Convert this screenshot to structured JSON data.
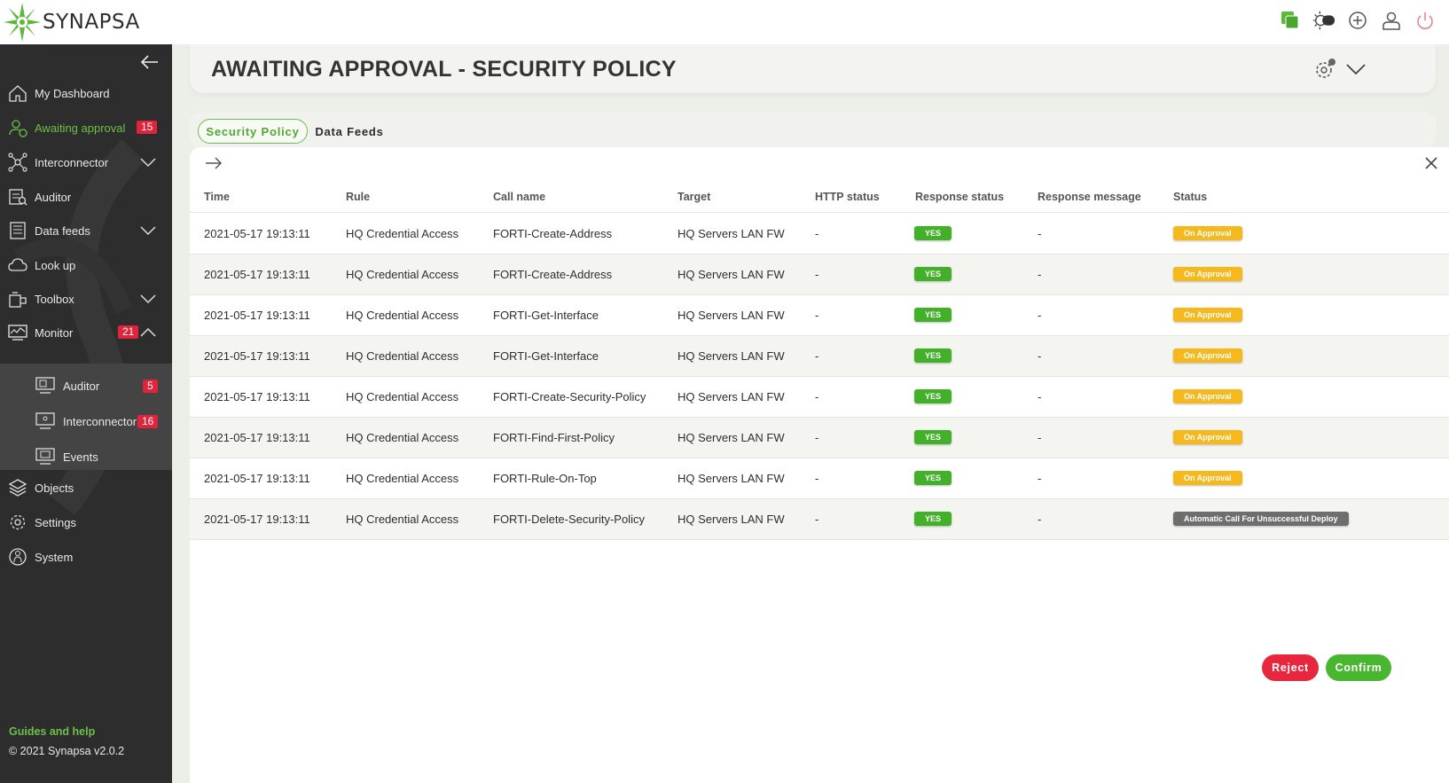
{
  "app": {
    "name": "SYNAPSA"
  },
  "topbar": {
    "icons": [
      "green-square-icon",
      "theme-toggle-icon",
      "add-circle-icon",
      "user-icon",
      "power-icon"
    ]
  },
  "sidebar": {
    "items": [
      {
        "label": "My Dashboard",
        "icon": "home-icon"
      },
      {
        "label": "Awaiting approval",
        "icon": "approval-user-icon",
        "badge": "15",
        "active": true
      },
      {
        "label": "Interconnector",
        "icon": "network-icon",
        "expandable": true
      },
      {
        "label": "Auditor",
        "icon": "auditor-icon"
      },
      {
        "label": "Data feeds",
        "icon": "data-feeds-icon",
        "expandable": true
      },
      {
        "label": "Look up",
        "icon": "cloud-icon"
      },
      {
        "label": "Toolbox",
        "icon": "toolbox-icon",
        "expandable": true
      },
      {
        "label": "Monitor",
        "icon": "monitor-icon",
        "badge": "21",
        "expanded": true
      },
      {
        "label": "Objects",
        "icon": "layers-icon"
      },
      {
        "label": "Settings",
        "icon": "settings-icon"
      },
      {
        "label": "System",
        "icon": "system-icon"
      }
    ],
    "monitor_sub": [
      {
        "label": "Auditor",
        "badge": "5"
      },
      {
        "label": "Interconnector",
        "badge": "16"
      },
      {
        "label": "Events",
        "badge": ""
      }
    ],
    "guides": "Guides and help",
    "copyright": "© 2021 Synapsa v2.0.2"
  },
  "header": {
    "title": "AWAITING APPROVAL - SECURITY POLICY"
  },
  "tabs": [
    {
      "label": "Security Policy",
      "active": true
    },
    {
      "label": "Data Feeds",
      "active": false
    }
  ],
  "table": {
    "columns": [
      "Time",
      "Rule",
      "Call name",
      "Target",
      "HTTP status",
      "Response status",
      "Response message",
      "Status"
    ],
    "rows": [
      {
        "time": "2021-05-17 19:13:11",
        "rule": "HQ Credential Access",
        "call": "FORTI-Create-Address",
        "target": "HQ Servers LAN FW",
        "http": "-",
        "response": "YES",
        "message": "-",
        "status": "On Approval",
        "status_color": "#f6b91d"
      },
      {
        "time": "2021-05-17 19:13:11",
        "rule": "HQ Credential Access",
        "call": "FORTI-Create-Address",
        "target": "HQ Servers LAN FW",
        "http": "-",
        "response": "YES",
        "message": "-",
        "status": "On Approval",
        "status_color": "#f6b91d"
      },
      {
        "time": "2021-05-17 19:13:11",
        "rule": "HQ Credential Access",
        "call": "FORTI-Get-Interface",
        "target": "HQ Servers LAN FW",
        "http": "-",
        "response": "YES",
        "message": "-",
        "status": "On Approval",
        "status_color": "#f6b91d"
      },
      {
        "time": "2021-05-17 19:13:11",
        "rule": "HQ Credential Access",
        "call": "FORTI-Get-Interface",
        "target": "HQ Servers LAN FW",
        "http": "-",
        "response": "YES",
        "message": "-",
        "status": "On Approval",
        "status_color": "#f6b91d"
      },
      {
        "time": "2021-05-17 19:13:11",
        "rule": "HQ Credential Access",
        "call": "FORTI-Create-Security-Policy",
        "target": "HQ Servers LAN FW",
        "http": "-",
        "response": "YES",
        "message": "-",
        "status": "On Approval",
        "status_color": "#f6b91d"
      },
      {
        "time": "2021-05-17 19:13:11",
        "rule": "HQ Credential Access",
        "call": "FORTI-Find-First-Policy",
        "target": "HQ Servers LAN FW",
        "http": "-",
        "response": "YES",
        "message": "-",
        "status": "On Approval",
        "status_color": "#f6b91d"
      },
      {
        "time": "2021-05-17 19:13:11",
        "rule": "HQ Credential Access",
        "call": "FORTI-Rule-On-Top",
        "target": "HQ Servers LAN FW",
        "http": "-",
        "response": "YES",
        "message": "-",
        "status": "On Approval",
        "status_color": "#f6b91d"
      },
      {
        "time": "2021-05-17 19:13:11",
        "rule": "HQ Credential Access",
        "call": "FORTI-Delete-Security-Policy",
        "target": "HQ Servers LAN FW",
        "http": "-",
        "response": "YES",
        "message": "-",
        "status": "Automatic Call For Unsuccessful Deploy",
        "status_color": "#6e6e6e"
      }
    ]
  },
  "actions": {
    "reject": "Reject",
    "confirm": "Confirm"
  },
  "colors": {
    "accent": "#6cc04a",
    "danger": "#e8273e",
    "warning": "#f6b91d",
    "sidebar": "#2d2d2d"
  }
}
